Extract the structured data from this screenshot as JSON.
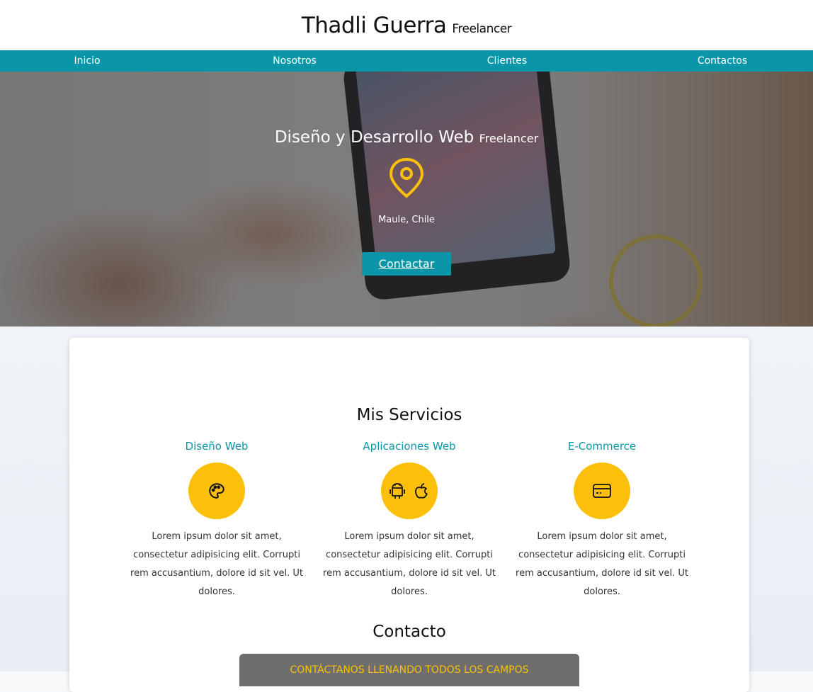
{
  "header": {
    "name": "Thadli Guerra",
    "role": "Freelancer"
  },
  "nav": {
    "items": [
      "Inicio",
      "Nosotros",
      "Clientes",
      "Contactos"
    ]
  },
  "hero": {
    "title": "Diseño y Desarrollo Web",
    "title_small": "Freelancer",
    "location": "Maule, Chile",
    "button": "Contactar"
  },
  "services": {
    "title": "Mis Servicios",
    "items": [
      {
        "name": "Diseño Web",
        "icon": "palette-icon",
        "text": "Lorem ipsum dolor sit amet, consectetur adipisicing elit. Corrupti rem accusantium, dolore id sit vel. Ut dolores."
      },
      {
        "name": "Aplicaciones Web",
        "icon": "android-apple-icon",
        "text": "Lorem ipsum dolor sit amet, consectetur adipisicing elit. Corrupti rem accusantium, dolore id sit vel. Ut dolores."
      },
      {
        "name": "E-Commerce",
        "icon": "credit-card-icon",
        "text": "Lorem ipsum dolor sit amet, consectetur adipisicing elit. Corrupti rem accusantium, dolore id sit vel. Ut dolores."
      }
    ]
  },
  "contact": {
    "title": "Contacto",
    "banner": "CONTÁCTANOS LLENANDO TODOS LOS CAMPOS"
  },
  "colors": {
    "accent": "#0a96a8",
    "yellow": "#fcc00a"
  }
}
